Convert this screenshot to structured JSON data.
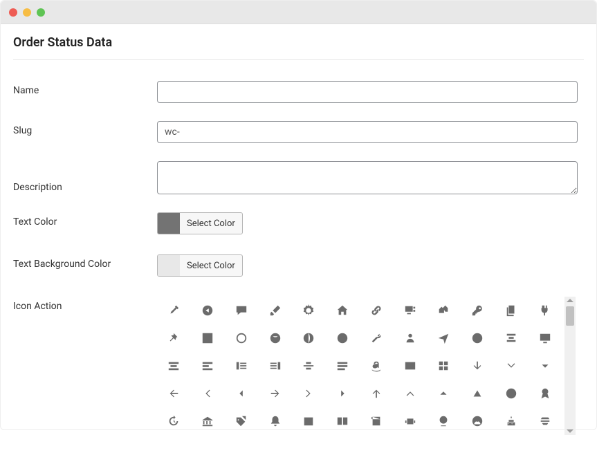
{
  "heading": "Order Status Data",
  "fields": {
    "name": {
      "label": "Name",
      "value": ""
    },
    "slug": {
      "label": "Slug",
      "value": "wc-"
    },
    "description": {
      "label": "Description",
      "value": ""
    },
    "text_color": {
      "label": "Text Color",
      "button": "Select Color",
      "swatch": "#737373"
    },
    "bg_color": {
      "label": "Text Background Color",
      "button": "Select Color",
      "swatch": "#e8e8e8"
    },
    "icon_action": {
      "label": "Icon Action"
    }
  },
  "icons": [
    [
      "dropper",
      "circle-play-left",
      "comment",
      "brush",
      "gear",
      "home",
      "link",
      "display-audio",
      "multi-home",
      "key",
      "copy-doc",
      "plug"
    ],
    [
      "pin",
      "sliders",
      "globe-outline",
      "globe-solid",
      "globe-grid",
      "globe-simple",
      "wrench",
      "user",
      "plane",
      "contrast",
      "align-hcenter",
      "monitor"
    ],
    [
      "align-box-center",
      "align-box-left",
      "align-left",
      "align-right",
      "align-just-center",
      "align-bars",
      "amazon",
      "id-card",
      "grid",
      "arrow-down",
      "chevron-down",
      "caret-down"
    ],
    [
      "arrow-left",
      "chevron-left",
      "caret-left",
      "arrow-right",
      "chevron-right",
      "caret-right",
      "arrow-up",
      "chevron-up",
      "caret-up",
      "triangle-up",
      "pie",
      "ribbon"
    ],
    [
      "history",
      "bank",
      "tags",
      "bell",
      "calendar",
      "book-open",
      "book-solid",
      "robot",
      "globe-stand",
      "user-circle",
      "cake",
      "stack-lines"
    ]
  ]
}
